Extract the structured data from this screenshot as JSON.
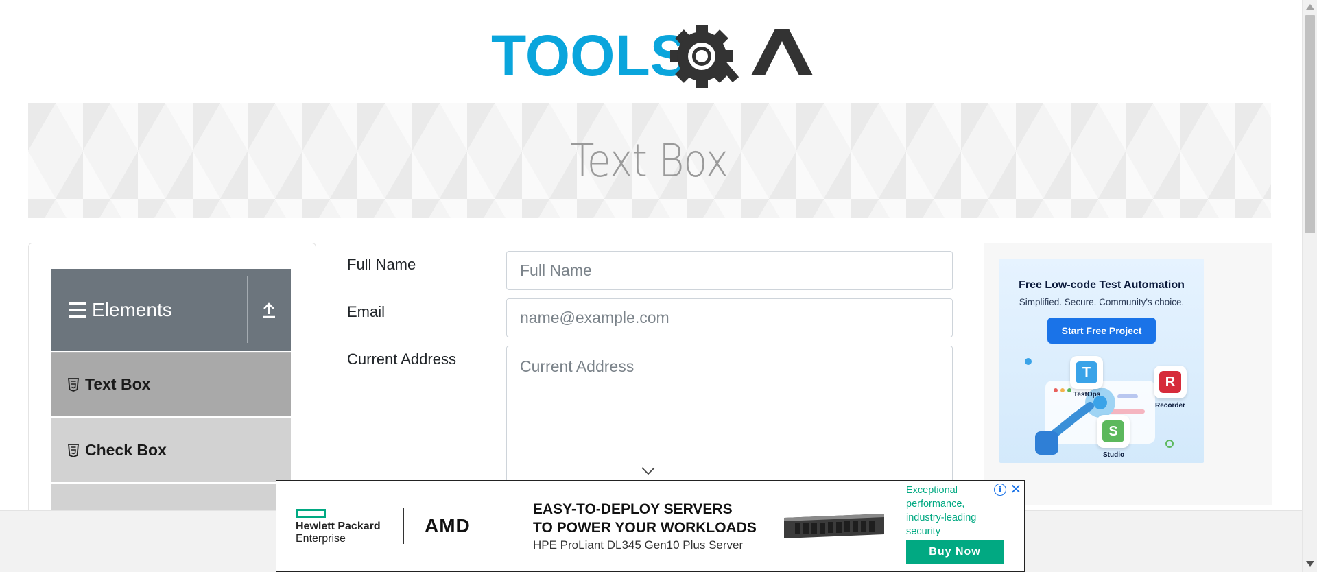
{
  "header": {
    "logo_text": "TOOLSQA",
    "logo_icon": "gear-magnifier-icon"
  },
  "banner": {
    "title": "Text Box"
  },
  "sidebar": {
    "group": {
      "title": "Elements",
      "menu_icon": "hamburger-icon",
      "collapse_icon": "upload-arrow-icon"
    },
    "items": [
      {
        "label": "Text Box",
        "icon": "html5-icon",
        "active": true
      },
      {
        "label": "Check Box",
        "icon": "html5-icon",
        "active": false
      }
    ]
  },
  "form": {
    "full_name": {
      "label": "Full Name",
      "placeholder": "Full Name",
      "value": ""
    },
    "email": {
      "label": "Email",
      "placeholder": "name@example.com",
      "value": ""
    },
    "current_address": {
      "label": "Current Address",
      "placeholder": "Current Address",
      "value": ""
    }
  },
  "side_ad": {
    "headline": "Free Low-code Test Automation",
    "subline": "Simplified. Secure. Community's choice.",
    "cta": "Start Free Project",
    "apps": [
      {
        "letter": "T",
        "caption": "TestOps",
        "color": "#3aa3e8"
      },
      {
        "letter": "R",
        "caption": "Recorder",
        "color": "#d62b3a"
      },
      {
        "letter": "S",
        "caption": "Studio",
        "color": "#5cb85c"
      }
    ]
  },
  "bottom_ad": {
    "brand_hpe_line1": "Hewlett Packard",
    "brand_hpe_line2": "Enterprise",
    "brand_amd": "AMD",
    "headline_line1": "EASY-TO-DEPLOY SERVERS",
    "headline_line2": "TO POWER YOUR WORKLOADS",
    "product": "HPE ProLiant DL345 Gen10 Plus Server",
    "tagline": "Exceptional performance, industry-leading security",
    "cta": "Buy Now",
    "adchoices_icon": "info-icon",
    "close_icon": "close-icon",
    "accent": "#01a982"
  },
  "colors": {
    "logo_blue": "#0aa5dc",
    "logo_dark": "#333333",
    "sidebar_header": "#6c757d"
  }
}
